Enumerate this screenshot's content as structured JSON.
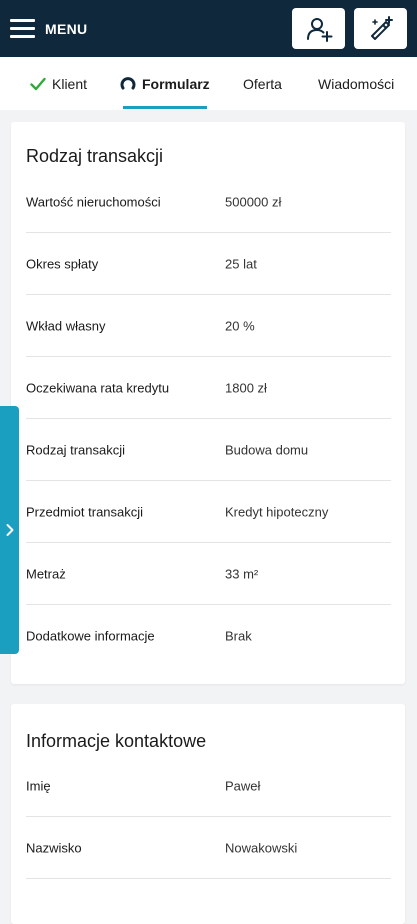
{
  "header": {
    "menu_label": "MENU",
    "actions": [
      {
        "icon": "add-user-icon"
      },
      {
        "icon": "magic-wand-icon"
      }
    ]
  },
  "tabs": [
    {
      "label": "Klient",
      "icon": "check-icon",
      "icon_color": "#2eaa3a"
    },
    {
      "label": "Formularz",
      "icon": "loading-arc-icon",
      "active": true
    },
    {
      "label": "Oferta"
    },
    {
      "label": "Wiadomości"
    }
  ],
  "accent_color": "#1b9fc0",
  "header_color": "#10283b",
  "transaction": {
    "title": "Rodzaj transakcji",
    "rows": [
      {
        "label": "Wartość nieruchomości",
        "value": "500000 zł"
      },
      {
        "label": "Okres spłaty",
        "value": "25 lat"
      },
      {
        "label": "Wkład własny",
        "value": "20 %"
      },
      {
        "label": "Oczekiwana rata kredytu",
        "value": "1800 zł"
      },
      {
        "label": "Rodzaj transakcji",
        "value": "Budowa domu"
      },
      {
        "label": "Przedmiot transakcji",
        "value": "Kredyt hipoteczny"
      },
      {
        "label": "Metraż",
        "value": "33 m²"
      },
      {
        "label": "Dodatkowe informacje",
        "value": "Brak"
      }
    ]
  },
  "contact": {
    "title": "Informacje kontaktowe",
    "rows": [
      {
        "label": "Imię",
        "value": "Paweł"
      },
      {
        "label": "Nazwisko",
        "value": "Nowakowski"
      }
    ]
  },
  "side_handle": {
    "icon": "chevron-right-icon"
  }
}
